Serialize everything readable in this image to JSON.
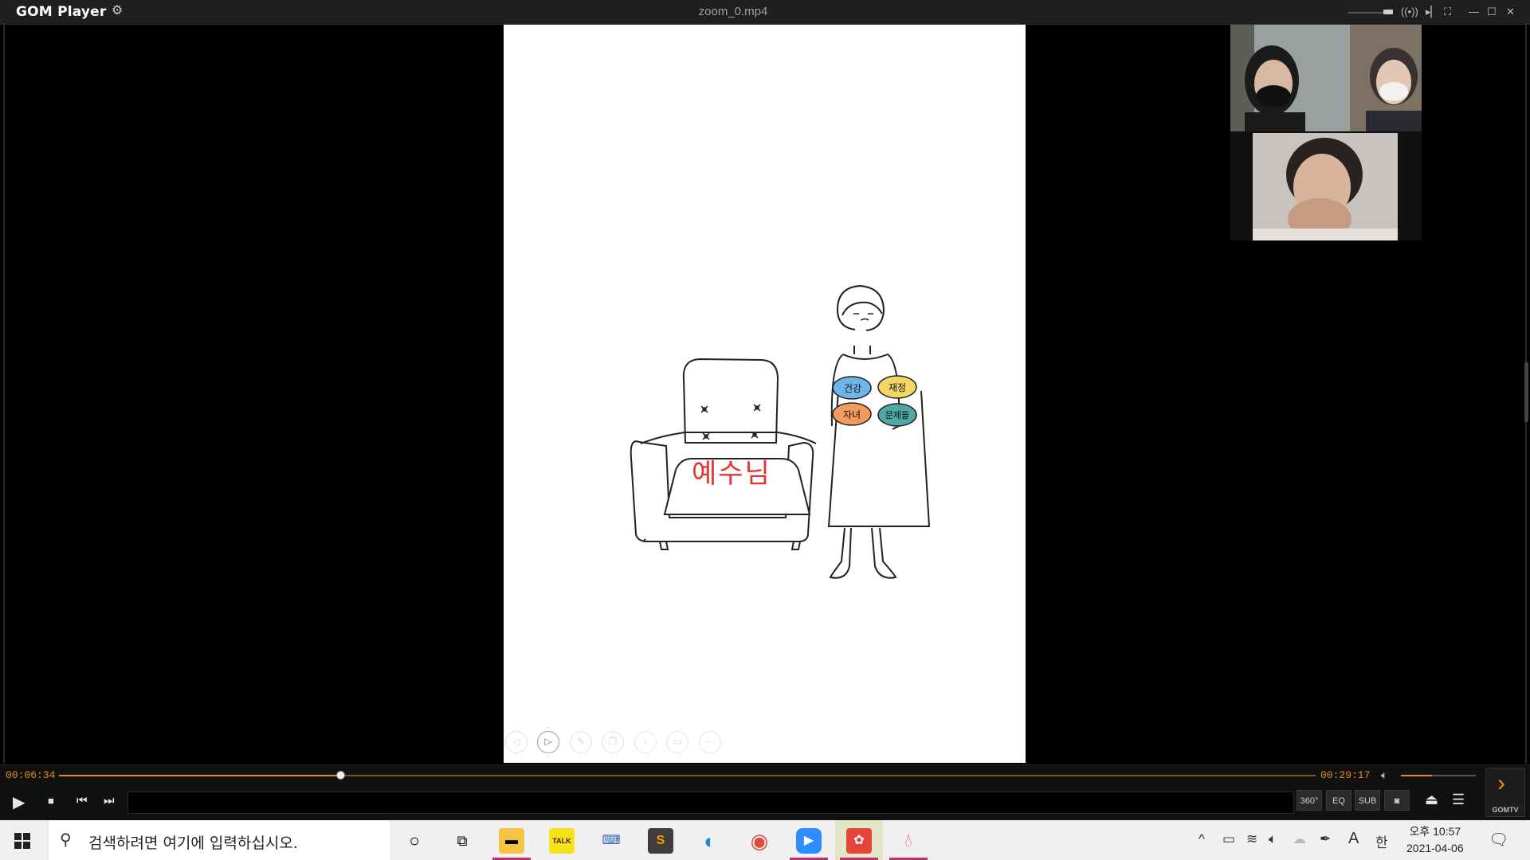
{
  "titlebar": {
    "logo_gom": "GOM",
    "logo_player": "Player",
    "gear_icon": "gear-icon",
    "file_name": "zoom_0.mp4",
    "window_controls": [
      "minimize",
      "maximize",
      "close"
    ]
  },
  "slide": {
    "seat_text": "예수님",
    "bubbles": [
      "건강",
      "재정",
      "자녀",
      "문제들"
    ],
    "toolbar_icons": [
      "prev-icon",
      "play-icon",
      "pen-icon",
      "copy-icon",
      "zoom-icon",
      "subtitle-icon",
      "more-icon"
    ]
  },
  "player": {
    "current_time": "00:06:34",
    "total_time": "00:29:17",
    "progress": 0.224,
    "volume": 0.42,
    "buttons": {
      "vr": "360°",
      "eq": "EQ",
      "sub": "SUB",
      "capture": "capture-icon",
      "eject": "eject-icon",
      "menu": "menu-icon"
    },
    "gomtv_label": "GOMTV"
  },
  "taskbar": {
    "search_placeholder": "검색하려면 여기에 입력하십시오.",
    "apps": [
      "file-explorer-icon",
      "kakaotalk-icon",
      "network-icon",
      "sublime-icon",
      "edge-icon",
      "chrome-icon",
      "zoom-icon",
      "app-icon",
      "droplet-icon"
    ],
    "kakao_label": "TALK",
    "ime_a": "A",
    "ime_han": "한",
    "clock_time": "오후 10:57",
    "clock_date": "2021-04-06"
  },
  "colors": {
    "accent": "#e38e1b",
    "seat_text": "#e8322d",
    "bubble_blue": "#6fb6e8",
    "bubble_yellow": "#f3d766",
    "bubble_orange": "#f39a5e",
    "bubble_teal": "#4fa8a2"
  }
}
